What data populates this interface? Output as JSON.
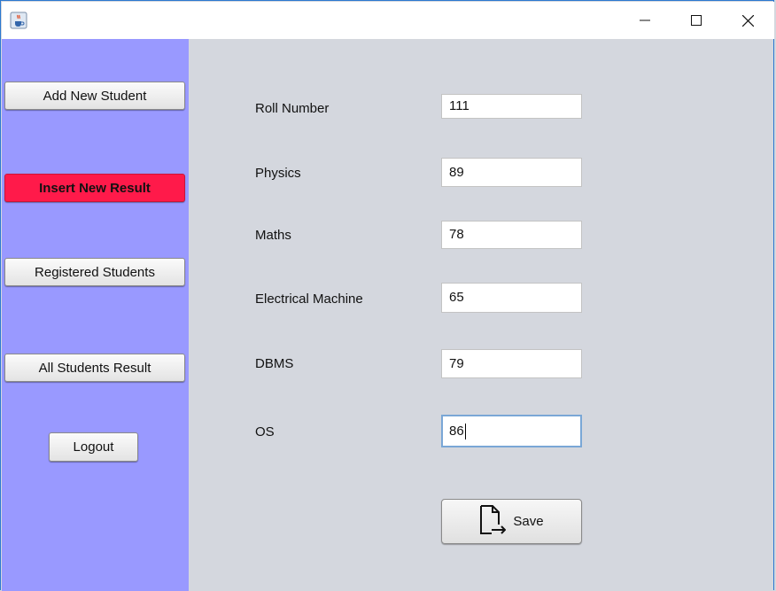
{
  "window": {
    "icon": "java-cup-icon",
    "controls": [
      "minimize-icon",
      "maximize-icon",
      "close-icon"
    ]
  },
  "sidebar": {
    "items": [
      {
        "label": "Add New Student",
        "active": false
      },
      {
        "label": "Insert New Result",
        "active": true
      },
      {
        "label": "Registered Students",
        "active": false
      },
      {
        "label": "All Students Result",
        "active": false
      }
    ],
    "logout_label": "Logout",
    "background": "#9999ff",
    "active_color": "#ff1a4a"
  },
  "form": {
    "fields": [
      {
        "label": "Roll Number",
        "value": "111"
      },
      {
        "label": "Physics",
        "value": "89"
      },
      {
        "label": "Maths",
        "value": "78"
      },
      {
        "label": "Electrical Machine",
        "value": "65"
      },
      {
        "label": "DBMS",
        "value": "79"
      },
      {
        "label": "OS",
        "value": "86"
      }
    ],
    "save_label": "Save",
    "save_icon": "save-file-icon"
  }
}
